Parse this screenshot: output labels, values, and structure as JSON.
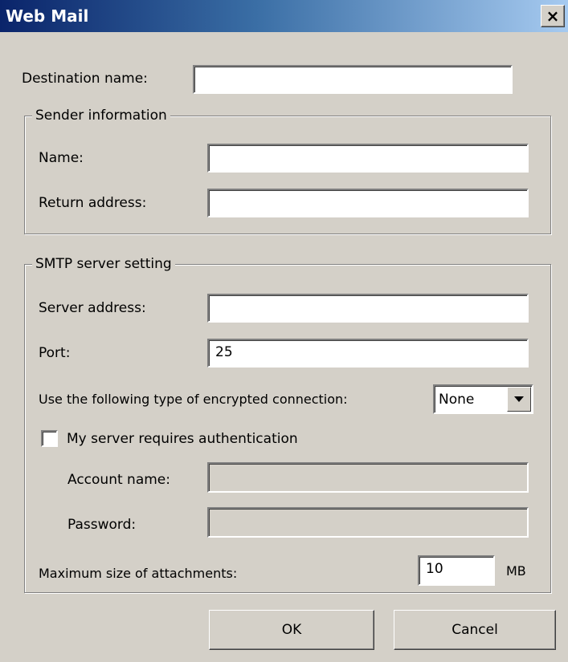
{
  "window": {
    "title": "Web Mail",
    "close_glyph": "×"
  },
  "destination": {
    "label": "Destination name:",
    "value": ""
  },
  "sender": {
    "legend": "Sender information",
    "name_label": "Name:",
    "name_value": "",
    "return_label": "Return address:",
    "return_value": ""
  },
  "smtp": {
    "legend": "SMTP server setting",
    "server_label": "Server address:",
    "server_value": "",
    "port_label": "Port:",
    "port_value": "25",
    "encryption_label": "Use the following type of encrypted connection:",
    "encryption_value": "None",
    "auth_label": "My server requires authentication",
    "auth_checked": false,
    "account_label": "Account name:",
    "account_value": "",
    "password_label": "Password:",
    "password_value": "",
    "attach_label": "Maximum size of attachments:",
    "attach_value": "10",
    "attach_unit": "MB"
  },
  "buttons": {
    "ok": "OK",
    "cancel": "Cancel"
  },
  "colors": {
    "dialog_bg": "#d4d0c8",
    "titlebar_start": "#0a246a",
    "titlebar_end": "#a6caf0"
  }
}
